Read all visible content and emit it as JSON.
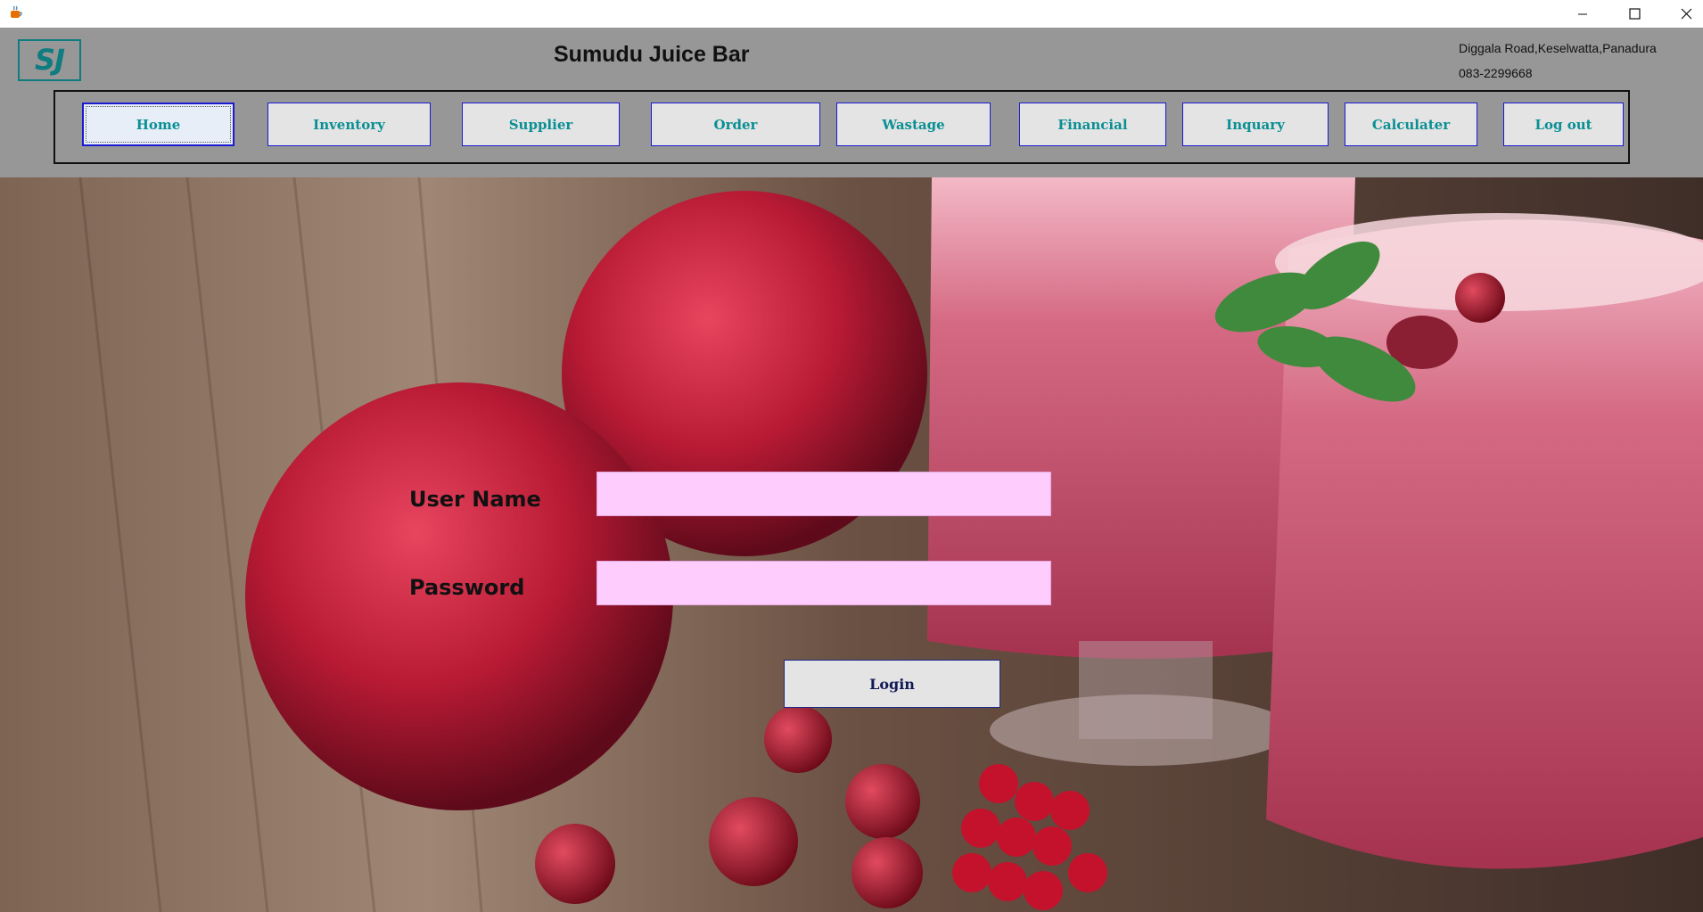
{
  "window": {
    "app_icon": "java-cup-icon",
    "controls": [
      "minimize-icon",
      "maximize-icon",
      "close-icon"
    ]
  },
  "header": {
    "logo_text": "SJ",
    "title": "Sumudu Juice Bar",
    "address": "Diggala Road,Keselwatta,Panadura",
    "phone": "083-2299668"
  },
  "nav": {
    "items": [
      {
        "label": "Home"
      },
      {
        "label": "Inventory"
      },
      {
        "label": "Supplier"
      },
      {
        "label": "Order"
      },
      {
        "label": "Wastage"
      },
      {
        "label": "Financial"
      },
      {
        "label": "Inquary"
      },
      {
        "label": "Calculater"
      },
      {
        "label": "Log out"
      }
    ],
    "active": "Home"
  },
  "login": {
    "username_label": "User Name",
    "username_value": "",
    "password_label": "Password",
    "password_value": "",
    "login_button": "Login"
  },
  "colors": {
    "header_bg": "#979797",
    "nav_text": "#0a8f94",
    "field_bg": "#fecdfd",
    "logo": "#0f7c80"
  }
}
